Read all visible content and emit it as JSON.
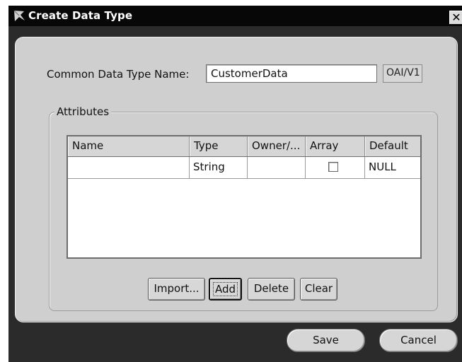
{
  "window": {
    "title": "Create Data Type",
    "close_glyph": "✕"
  },
  "form": {
    "name_label": "Common Data Type Name:",
    "name_value": "CustomerData",
    "namespace_value": "OAI/V1"
  },
  "attributes": {
    "group_label": "Attributes",
    "columns": [
      "Name",
      "Type",
      "Owner/...",
      "Array",
      "Default"
    ],
    "rows": [
      {
        "name": "",
        "type": "String",
        "owner": "",
        "array": false,
        "default": "NULL"
      }
    ]
  },
  "buttons": {
    "import": "Import...",
    "add": "Add",
    "delete": "Delete",
    "clear": "Clear"
  },
  "footer": {
    "save": "Save",
    "cancel": "Cancel"
  },
  "icons": {
    "app": "data-type-icon",
    "close": "close-icon",
    "checkbox": "checkbox-unchecked"
  },
  "colors": {
    "titlebar": "#070707",
    "panel": "#cfcfcf",
    "frame": "#2b2b2b"
  }
}
